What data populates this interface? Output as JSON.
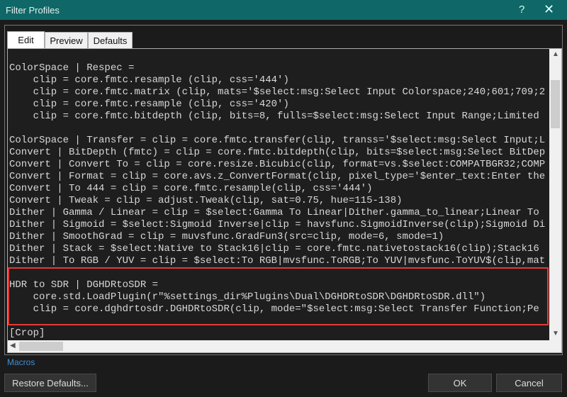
{
  "window": {
    "title": "Filter Profiles",
    "help_label": "?",
    "close_label": "✕"
  },
  "tabs": [
    {
      "label": "Edit",
      "active": true
    },
    {
      "label": "Preview"
    },
    {
      "label": "Defaults"
    }
  ],
  "editor": {
    "lines": [
      "",
      "ColorSpace | Respec =",
      "    clip = core.fmtc.resample (clip, css='444')",
      "    clip = core.fmtc.matrix (clip, mats='$select:msg:Select Input Colorspace;240;601;709;2",
      "    clip = core.fmtc.resample (clip, css='420')",
      "    clip = core.fmtc.bitdepth (clip, bits=8, fulls=$select:msg:Select Input Range;Limited",
      "",
      "ColorSpace | Transfer = clip = core.fmtc.transfer(clip, transs='$select:msg:Select Input;L",
      "Convert | BitDepth (fmtc) = clip = core.fmtc.bitdepth(clip, bits=$select:msg:Select BitDep",
      "Convert | Convert To = clip = core.resize.Bicubic(clip, format=vs.$select:COMPATBGR32;COMP",
      "Convert | Format = clip = core.avs.z_ConvertFormat(clip, pixel_type='$enter_text:Enter the",
      "Convert | To 444 = clip = core.fmtc.resample(clip, css='444')",
      "Convert | Tweak = clip = adjust.Tweak(clip, sat=0.75, hue=115-138)",
      "Dither | Gamma / Linear = clip = $select:Gamma To Linear|Dither.gamma_to_linear;Linear To",
      "Dither | Sigmoid = $select:Sigmoid Inverse|clip = havsfunc.SigmoidInverse(clip);Sigmoid Di",
      "Dither | SmoothGrad = clip = muvsfunc.GradFun3(src=clip, mode=6, smode=1)",
      "Dither | Stack = $select:Native to Stack16|clip = core.fmtc.nativetostack16(clip);Stack16",
      "Dither | To RGB / YUV = clip = $select:To RGB|mvsfunc.ToRGB;To YUV|mvsfunc.ToYUV$(clip,mat",
      "",
      "HDR to SDR | DGHDRtoSDR =",
      "    core.std.LoadPlugin(r\"%settings_dir%Plugins\\Dual\\DGHDRtoSDR\\DGHDRtoSDR.dll\")",
      "    clip = core.dghdrtosdr.DGHDRtoSDR(clip, mode=\"$select:msg:Select Transfer Function;Pe",
      "",
      "[Crop]"
    ]
  },
  "macros_link": "Macros",
  "buttons": {
    "restore": "Restore Defaults...",
    "ok": "OK",
    "cancel": "Cancel"
  },
  "colors": {
    "titlebar": "#0f6767",
    "highlight": "#e53935",
    "link": "#3d8fd6"
  }
}
